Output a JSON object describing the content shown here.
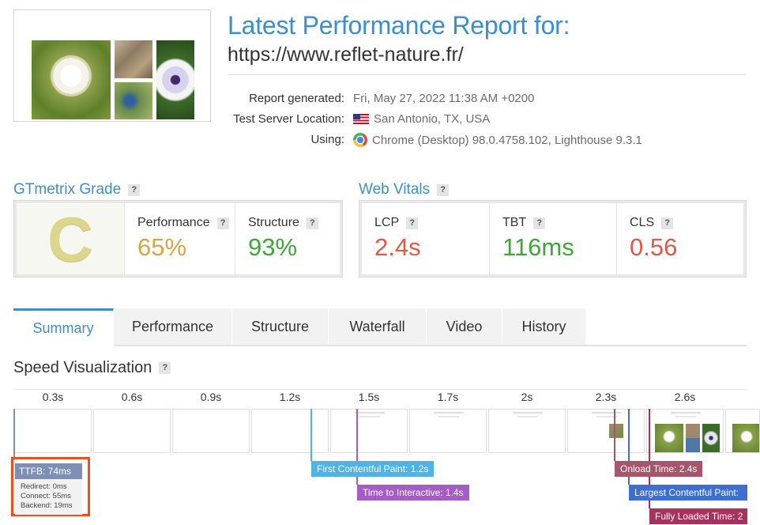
{
  "header": {
    "title": "Latest Performance Report for:",
    "url": "https://www.reflet-nature.fr/",
    "report_generated_label": "Report generated:",
    "report_generated_value": "Fri, May 27, 2022 11:38 AM +0200",
    "server_label": "Test Server Location:",
    "server_value": "San Antonio, TX, USA",
    "using_label": "Using:",
    "using_value": "Chrome (Desktop) 98.0.4758.102, Lighthouse 9.3.1",
    "flag_icon": "us-flag-icon",
    "browser_icon": "chrome-icon"
  },
  "gtmetrix_grade": {
    "heading": "GTmetrix Grade",
    "grade": "C",
    "performance_label": "Performance",
    "performance_value": "65%",
    "structure_label": "Structure",
    "structure_value": "93%",
    "colors": {
      "grade": "#dcd68c",
      "performance": "#d9a441",
      "structure": "#3fa639"
    }
  },
  "web_vitals": {
    "heading": "Web Vitals",
    "lcp_label": "LCP",
    "lcp_value": "2.4s",
    "tbt_label": "TBT",
    "tbt_value": "116ms",
    "cls_label": "CLS",
    "cls_value": "0.56",
    "colors": {
      "lcp": "#e05a4a",
      "tbt": "#3fa639",
      "cls": "#e05a4a"
    }
  },
  "help_mark": "?",
  "tabs": [
    {
      "label": "Summary",
      "active": true
    },
    {
      "label": "Performance",
      "active": false
    },
    {
      "label": "Structure",
      "active": false
    },
    {
      "label": "Waterfall",
      "active": false
    },
    {
      "label": "Video",
      "active": false
    },
    {
      "label": "History",
      "active": false
    }
  ],
  "speed_visualization": {
    "heading": "Speed Visualization",
    "ticks": [
      "0.3s",
      "0.6s",
      "0.9s",
      "1.2s",
      "1.5s",
      "1.7s",
      "2s",
      "2.3s",
      "2.6s"
    ],
    "ttfb": {
      "label": "TTFB: 74ms",
      "redirect": "Redirect: 0ms",
      "connect": "Connect: 55ms",
      "backend": "Backend: 19ms"
    },
    "markers": {
      "first_contentful_paint": "First Contentful Paint: 1.2s",
      "time_to_interactive": "Time to Interactive: 1.4s",
      "onload_time": "Onload Time: 2.4s",
      "largest_contentful_paint": "Largest Contentful Paint:",
      "fully_loaded_time": "Fully Loaded Time: 2"
    },
    "colors": {
      "ttfb": "#7e8fb3",
      "first_contentful_paint": "#4fb3e3",
      "time_to_interactive": "#a35dc4",
      "onload_time": "#a6556b",
      "largest_contentful_paint": "#3d6fd1",
      "fully_loaded_time": "#a8325c"
    }
  }
}
